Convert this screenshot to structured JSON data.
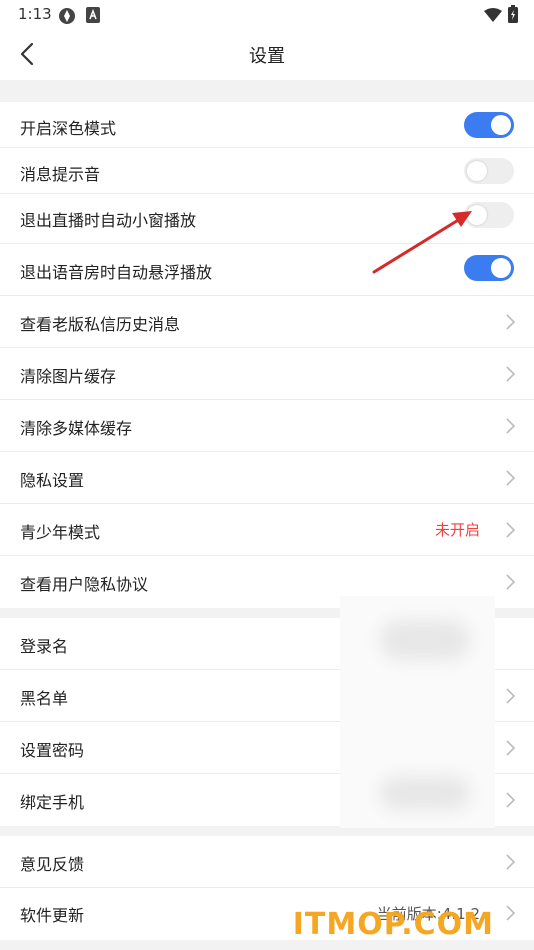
{
  "status_bar": {
    "time": "1:13"
  },
  "nav": {
    "title": "设置"
  },
  "section1": [
    {
      "label": "开启深色模式",
      "toggle": "on"
    },
    {
      "label": "消息提示音",
      "toggle": "off"
    },
    {
      "label": "退出直播时自动小窗播放",
      "toggle": "off"
    },
    {
      "label": "退出语音房时自动悬浮播放",
      "toggle": "on"
    },
    {
      "label": "查看老版私信历史消息"
    },
    {
      "label": "清除图片缓存"
    },
    {
      "label": "清除多媒体缓存"
    },
    {
      "label": "隐私设置"
    },
    {
      "label": "青少年模式",
      "value": "未开启"
    },
    {
      "label": "查看用户隐私协议"
    }
  ],
  "section2": [
    {
      "label": "登录名"
    },
    {
      "label": "黑名单"
    },
    {
      "label": "设置密码"
    },
    {
      "label": "绑定手机"
    }
  ],
  "section3": [
    {
      "label": "意见反馈"
    },
    {
      "label": "软件更新",
      "value": "当前版本:4.1.2"
    }
  ],
  "colors": {
    "accent": "#3b7df0",
    "warning": "#f04040",
    "annotation_arrow": "#d42a2a"
  },
  "watermark": "ITMOP.COM"
}
